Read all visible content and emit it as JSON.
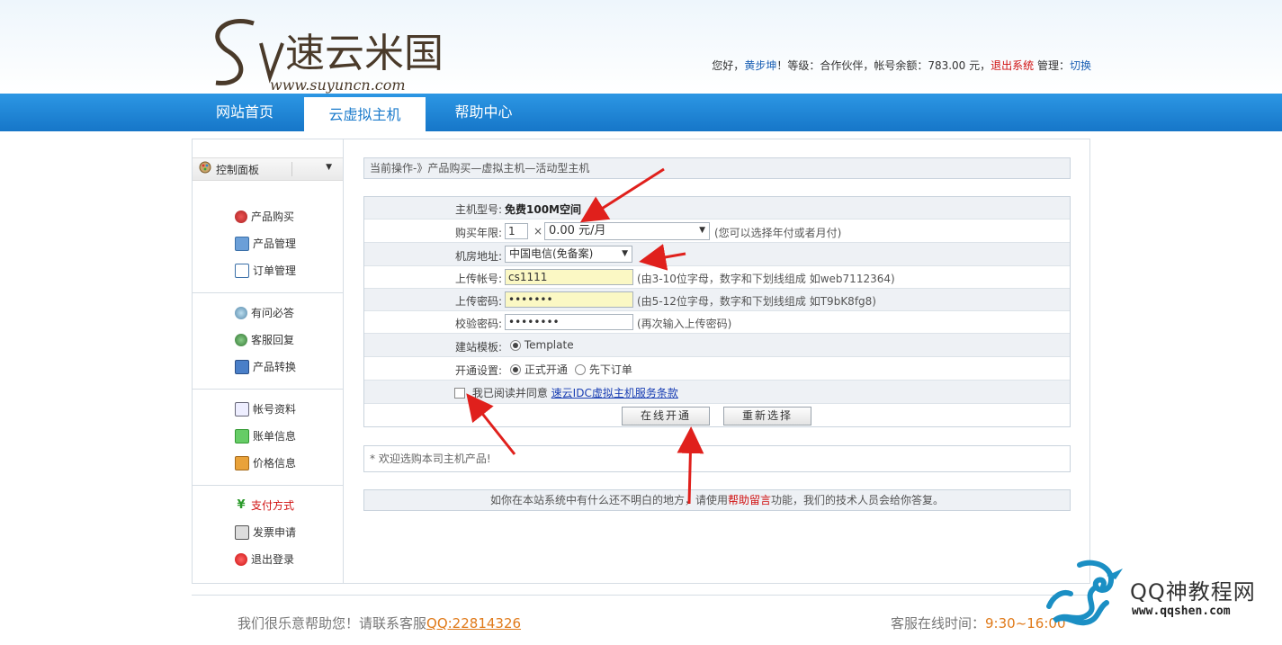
{
  "header": {
    "user_greeting": "您好，",
    "user_name": "黄步坤",
    "level_text": "！等级：合作伙伴，帐号余额：783.00 元，",
    "logout": "退出系统",
    "manage": " 管理：",
    "switch": "切换"
  },
  "nav": {
    "tabs": [
      {
        "label": "网站首页"
      },
      {
        "label": "云虚拟主机"
      },
      {
        "label": "帮助中心"
      }
    ]
  },
  "sidebar": {
    "panel_title": "控制面板",
    "groups": [
      [
        {
          "label": "产品购买",
          "icon": "cart-icon"
        },
        {
          "label": "产品管理",
          "icon": "manage-icon"
        },
        {
          "label": "订单管理",
          "icon": "order-icon"
        }
      ],
      [
        {
          "label": "有问必答",
          "icon": "chat-icon"
        },
        {
          "label": "客服回复",
          "icon": "service-icon"
        },
        {
          "label": "产品转换",
          "icon": "convert-icon"
        }
      ],
      [
        {
          "label": "帐号资料",
          "icon": "profile-icon"
        },
        {
          "label": "账单信息",
          "icon": "bill-icon"
        },
        {
          "label": "价格信息",
          "icon": "price-icon"
        }
      ],
      [
        {
          "label": "支付方式",
          "icon": "yen-icon"
        },
        {
          "label": "发票申请",
          "icon": "invoice-icon"
        },
        {
          "label": "退出登录",
          "icon": "exit-icon"
        }
      ]
    ]
  },
  "breadcrumb": "当前操作-》产品购买—虚拟主机—活动型主机",
  "form": {
    "host_type_label": "主机型号:",
    "host_type_value": "免费100M空间",
    "years_label": "购买年限:",
    "years_value": "1",
    "times": "×",
    "price_value": "0.00 元/月",
    "years_hint": "(您可以选择年付或者月付)",
    "room_label": "机房地址:",
    "room_value": "中国电信(免备案)",
    "account_label": "上传帐号:",
    "account_value": "cs1111",
    "account_hint": "(由3-10位字母，数字和下划线组成 如web7112364)",
    "password_label": "上传密码:",
    "password_value": "•••••••",
    "password_hint": "(由5-12位字母，数字和下划线组成 如T9bK8fg8)",
    "confirm_label": "校验密码:",
    "confirm_value": "••••••••",
    "confirm_hint": "(再次输入上传密码)",
    "template_label": "建站模板:",
    "template_option": "Template",
    "open_label": "开通设置:",
    "open_option1": "正式开通",
    "open_option2": "先下订单",
    "agree_text": "我已阅读并同意",
    "agree_link": "速云IDC虚拟主机服务条款",
    "submit": "在线开通",
    "reset": "重新选择"
  },
  "notice": "* 欢迎选购本司主机产品!",
  "help": {
    "before": "如你在本站系统中有什么还不明白的地方，请使用",
    "em": "帮助留言",
    "after": "功能，我们的技术人员会给你答复。"
  },
  "footer": {
    "left_text": "我们很乐意帮助您！请联系客服",
    "qq": "QQ:22814326",
    "right_text": "客服在线时间：",
    "time": "9:30~16:00"
  },
  "watermark": {
    "title": "QQ神教程网",
    "url": "www.qqshen.com"
  },
  "logo": {
    "text": "速云米国",
    "url": "www.suyuncn.com"
  }
}
